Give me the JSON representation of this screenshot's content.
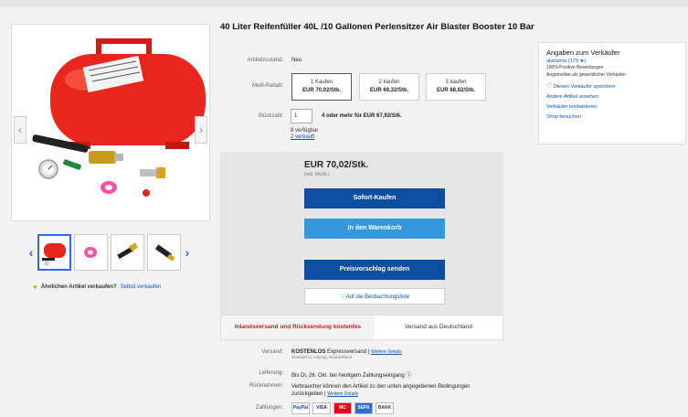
{
  "title": "40 Liter Reifenfüller 40L /10 Gallonen Perlensitzer Air Blaster Booster 10 Bar",
  "gallery": {
    "prev_glyph": "‹",
    "next_glyph": "›",
    "thumb_prev": "‹",
    "thumb_next": "›"
  },
  "sell_similar": {
    "question": "Ähnlichen Artikel verkaufen?",
    "link": "Selbst verkaufen"
  },
  "condition": {
    "label": "Artikelzustand:",
    "value": "Neu"
  },
  "multi_discount": {
    "label": "Multi-Rabatt:",
    "options": [
      {
        "qty": "1 Kaufen",
        "price": "EUR 70,02/Stk."
      },
      {
        "qty": "2 kaufen",
        "price": "EUR 69,32/Stk."
      },
      {
        "qty": "3 kaufen",
        "price": "EUR 68,62/Stk."
      }
    ]
  },
  "quantity": {
    "label": "Stückzahl:",
    "value": "1",
    "more_offer": "4 oder mehr für EUR 67,92/Stk.",
    "available": "8 verfügbar",
    "sold": "2 verkauft"
  },
  "buy": {
    "price": "EUR 70,02/Stk.",
    "price_note": "(inkl. MwSt.)",
    "buy_now": "Sofort-Kaufen",
    "add_to_cart": "In den Warenkorb",
    "make_offer": "Preisvorschlag senden",
    "watch": "Auf die Beobachtungsliste"
  },
  "shipping_tabs": {
    "free": "Inlandsversand und Rücksendung kostenlos",
    "from": "Versand aus Deutschland"
  },
  "details": {
    "shipping_label": "Versand:",
    "shipping_value": "KOSTENLOS",
    "shipping_method": "Expressversand",
    "shipping_link": "Weitere Details",
    "shipping_location": "Standort in: Leipzig, Deutschland",
    "delivery_label": "Lieferung:",
    "delivery_value": "Bis Di, 26. Okt. bei heutigem Zahlungseingang",
    "returns_label": "Rücknahmen:",
    "returns_value": "Verbraucher können den Artikel zu den unten angegebenen Bedingungen",
    "returns_value2": "zurückgeben",
    "returns_link": "Weitere Details",
    "payment_label": "Zahlungen:",
    "payment_methods": [
      "PayPal",
      "VISA",
      "MC",
      "SEPA",
      "BANK"
    ]
  },
  "seller": {
    "heading": "Angaben zum Verkäufer",
    "name": "afactorss",
    "rating": "(179 ★)",
    "positive": "100% Positive Bewertungen",
    "business": "Angemeldet als gewerblicher Verkäufer",
    "save": "Diesen Verkäufer speichern",
    "other_items": "Andere Artikel ansehen",
    "contact": "Verkäufer kontaktieren",
    "shop": "Shop besuchen"
  },
  "colors": {
    "primary_button": "#0b4ea2",
    "secondary_button": "#3498db",
    "link": "#0654ba",
    "free_shipping": "#c7211c",
    "product_red": "#e8261b"
  }
}
